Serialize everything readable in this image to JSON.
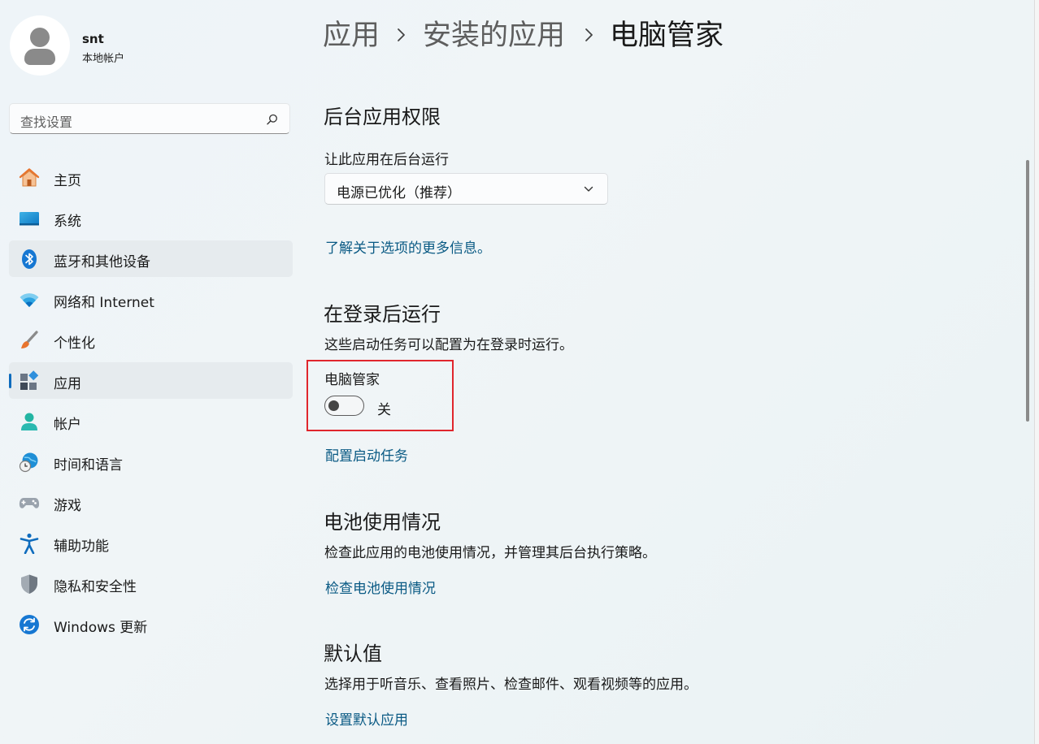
{
  "user": {
    "name": "snt",
    "type": "本地帐户"
  },
  "search": {
    "placeholder": "查找设置"
  },
  "nav": {
    "items": [
      {
        "label": "主页",
        "icon": "home-icon",
        "selected": false
      },
      {
        "label": "系统",
        "icon": "system-display-icon",
        "selected": false
      },
      {
        "label": "蓝牙和其他设备",
        "icon": "bluetooth-icon",
        "selected": true
      },
      {
        "label": "网络和 Internet",
        "icon": "wifi-icon",
        "selected": false
      },
      {
        "label": "个性化",
        "icon": "paintbrush-icon",
        "selected": false
      },
      {
        "label": "应用",
        "icon": "apps-icon",
        "selected": true,
        "active": true
      },
      {
        "label": "帐户",
        "icon": "account-icon",
        "selected": false
      },
      {
        "label": "时间和语言",
        "icon": "time-language-icon",
        "selected": false
      },
      {
        "label": "游戏",
        "icon": "gamepad-icon",
        "selected": false
      },
      {
        "label": "辅助功能",
        "icon": "accessibility-icon",
        "selected": false
      },
      {
        "label": "隐私和安全性",
        "icon": "shield-icon",
        "selected": false
      },
      {
        "label": "Windows 更新",
        "icon": "windows-update-icon",
        "selected": false
      }
    ]
  },
  "breadcrumb": {
    "level1": "应用",
    "level2": "安装的应用",
    "current": "电脑管家"
  },
  "background_permissions": {
    "heading": "后台应用权限",
    "label": "让此应用在后台运行",
    "selected": "电源已优化（推荐）",
    "link": "了解关于选项的更多信息。"
  },
  "startup": {
    "heading": "在登录后运行",
    "description": "这些启动任务可以配置为在登录时运行。",
    "task_name": "电脑管家",
    "toggle_state": "关",
    "toggle_on": false,
    "link": "配置启动任务"
  },
  "battery": {
    "heading": "电池使用情况",
    "description": "检查此应用的电池使用情况，并管理其后台执行策略。",
    "link": "检查电池使用情况"
  },
  "defaults": {
    "heading": "默认值",
    "description": "选择用于听音乐、查看照片、检查邮件、观看视频等的应用。",
    "link": "设置默认应用"
  },
  "colors": {
    "accent": "#0f6cbd",
    "link": "#0a5a84",
    "highlight_border": "#e0262d"
  }
}
